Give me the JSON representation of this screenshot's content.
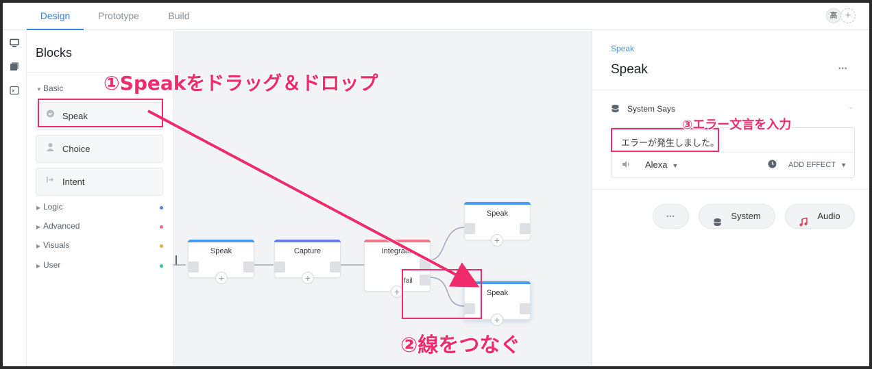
{
  "tabs": [
    {
      "label": "Design",
      "active": true
    },
    {
      "label": "Prototype",
      "active": false
    },
    {
      "label": "Build",
      "active": false
    }
  ],
  "user": {
    "avatar_text": "高",
    "add_label": "+"
  },
  "rail": {
    "icons": [
      "monitor-icon",
      "pages-icon",
      "terminal-icon"
    ]
  },
  "blocks": {
    "title": "Blocks",
    "basic": {
      "label": "Basic",
      "items": [
        {
          "label": "Speak",
          "icon": "speech-bubble-icon"
        },
        {
          "label": "Choice",
          "icon": "person-icon"
        },
        {
          "label": "Intent",
          "icon": "arrow-into-icon"
        }
      ]
    },
    "sections": [
      {
        "label": "Logic",
        "color": "#5b7de8"
      },
      {
        "label": "Advanced",
        "color": "#f06a86"
      },
      {
        "label": "Visuals",
        "color": "#f5a742"
      },
      {
        "label": "User",
        "color": "#2ec4a0"
      }
    ]
  },
  "canvas": {
    "nodes": [
      {
        "title": "Speak",
        "color": "#4a9af0"
      },
      {
        "title": "Capture",
        "color": "#6a7ee8"
      },
      {
        "title": "Integratio",
        "color": "#f07a8a",
        "fail_label": "fail"
      },
      {
        "title": "Speak",
        "color": "#4a9af0"
      },
      {
        "title": "Speak",
        "color": "#4a9af0"
      }
    ],
    "plus": "+"
  },
  "panel": {
    "breadcrumb": "Speak",
    "title": "Speak",
    "more": "•••",
    "system_says": "System Says",
    "message": "エラーが発生しました。",
    "voice": "Alexa",
    "add_effect": "ADD EFFECT",
    "buttons": {
      "more": "•••",
      "system": "System",
      "audio": "Audio"
    }
  },
  "annotations": {
    "step1": "①Speakをドラッグ＆ドロップ",
    "step2": "②線をつなぐ",
    "step3": "③エラー文言を入力"
  },
  "colors": {
    "accent": "#3a7fd9",
    "annotation": "#ef2b6b"
  }
}
